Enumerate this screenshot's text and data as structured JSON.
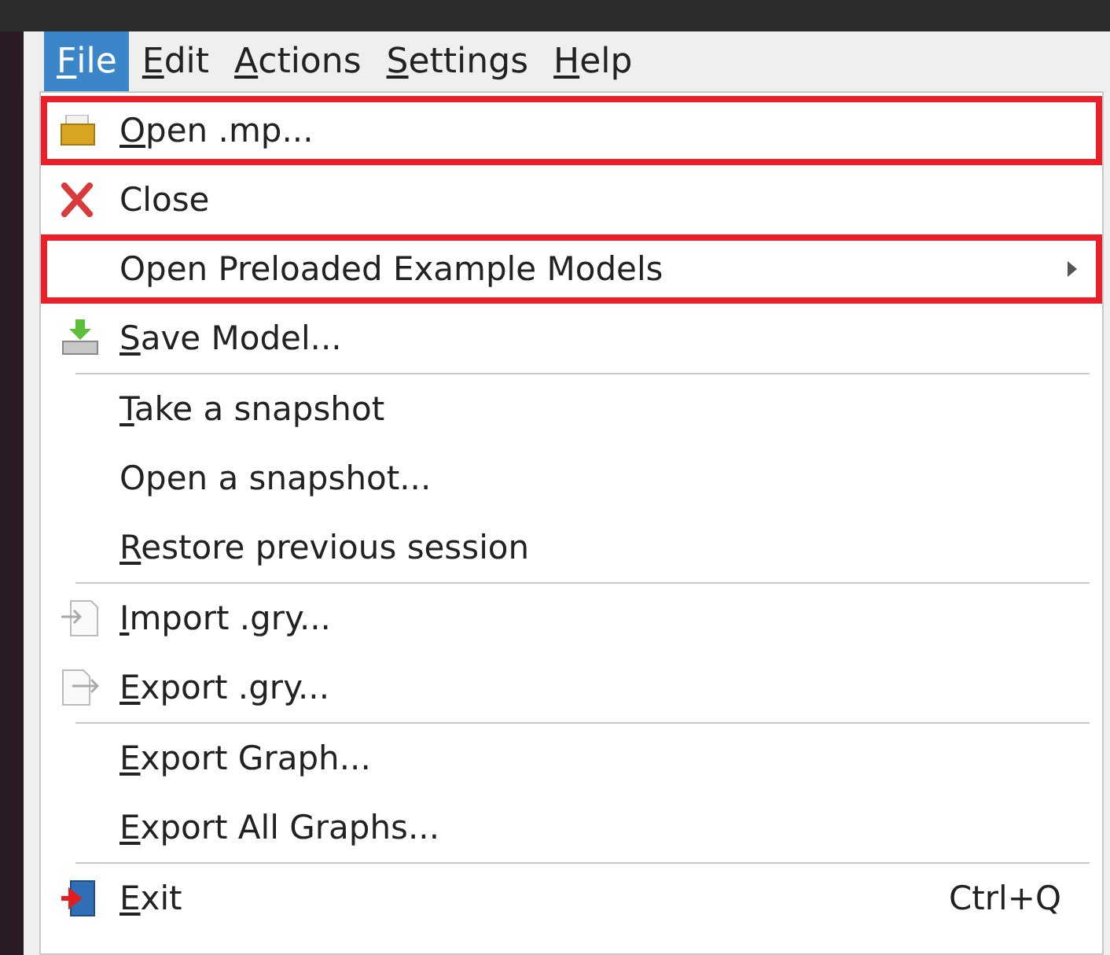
{
  "menubar": [
    {
      "mnemonic": "F",
      "rest": "ile",
      "selected": true
    },
    {
      "mnemonic": "E",
      "rest": "dit",
      "selected": false
    },
    {
      "mnemonic": "A",
      "rest": "ctions",
      "selected": false
    },
    {
      "mnemonic": "S",
      "rest": "ettings",
      "selected": false
    },
    {
      "mnemonic": "H",
      "rest": "elp",
      "selected": false
    }
  ],
  "file_menu": [
    {
      "kind": "item",
      "mnemonic": "O",
      "rest": "pen .mp...",
      "highlighted": true
    },
    {
      "kind": "item",
      "rest": "Close",
      "highlighted": false
    },
    {
      "kind": "submenu",
      "rest": "Open Preloaded Example Models",
      "highlighted": true
    },
    {
      "kind": "item",
      "mnemonic": "S",
      "rest": "ave Model...",
      "highlighted": false
    },
    {
      "kind": "separator"
    },
    {
      "kind": "item",
      "mnemonic": "T",
      "rest": "ake a snapshot",
      "highlighted": false
    },
    {
      "kind": "item",
      "rest": "Open a snapshot...",
      "highlighted": false
    },
    {
      "kind": "item",
      "mnemonic": "R",
      "rest": "estore previous session",
      "highlighted": false
    },
    {
      "kind": "separator"
    },
    {
      "kind": "item",
      "mnemonic": "I",
      "rest": "mport .gry...",
      "highlighted": false
    },
    {
      "kind": "item",
      "mnemonic": "E",
      "rest": "xport .gry...",
      "highlighted": false
    },
    {
      "kind": "separator"
    },
    {
      "kind": "item",
      "mnemonic": "E",
      "rest": "xport Graph...",
      "highlighted": false
    },
    {
      "kind": "item",
      "mnemonic": "E",
      "rest": "xport All Graphs...",
      "highlighted": false
    },
    {
      "kind": "separator"
    },
    {
      "kind": "item",
      "mnemonic": "E",
      "rest": "xit",
      "shortcut": "Ctrl+Q",
      "highlighted": false
    }
  ]
}
